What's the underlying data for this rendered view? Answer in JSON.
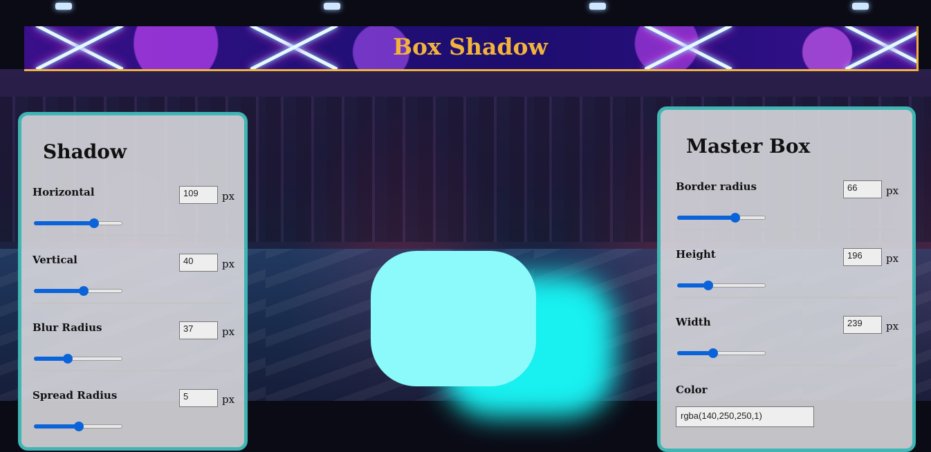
{
  "header": {
    "title": "Box Shadow"
  },
  "shadow_panel": {
    "title": "Shadow",
    "unit": "px",
    "controls": [
      {
        "label": "Horizontal",
        "value": "109",
        "level": 0.68
      },
      {
        "label": "Vertical",
        "value": "40",
        "level": 0.56
      },
      {
        "label": "Blur Radius",
        "value": "37",
        "level": 0.38
      },
      {
        "label": "Spread Radius",
        "value": "5",
        "level": 0.51
      }
    ]
  },
  "master_panel": {
    "title": "Master Box",
    "unit": "px",
    "controls": [
      {
        "label": "Border radius",
        "value": "66",
        "level": 0.66
      },
      {
        "label": "Height",
        "value": "196",
        "level": 0.35
      },
      {
        "label": "Width",
        "value": "239",
        "level": 0.41
      }
    ],
    "color": {
      "label": "Color",
      "value": "rgba(140,250,250,1)"
    }
  },
  "preview": {
    "background": "#8cfafa",
    "shadow_color": "#19f0f0"
  }
}
